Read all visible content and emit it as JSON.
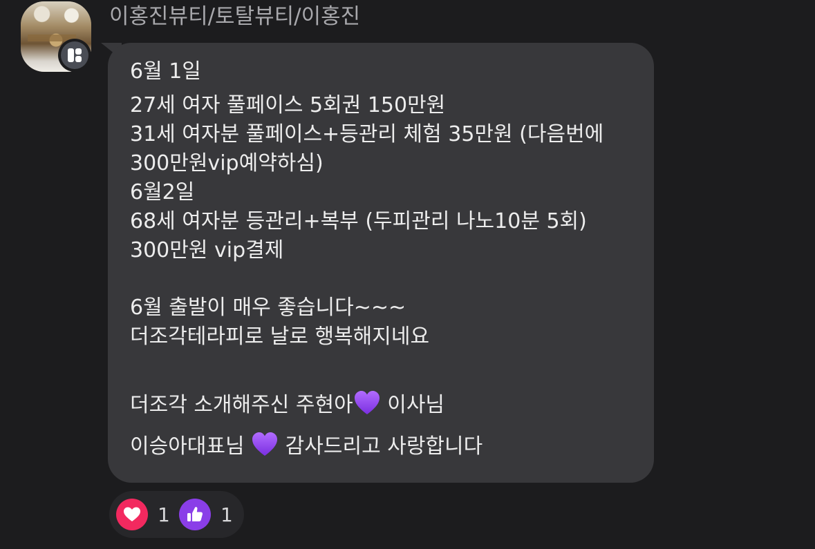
{
  "sender": {
    "name": "이홍진뷰티/토탈뷰티/이홍진"
  },
  "message": {
    "lines": [
      "6월 1일",
      "27세 여자   풀페이스 5회권 150만원",
      "31세 여자분 풀페이스+등관리 체험 35만원 (다음번에",
      "300만원vip예약하심)",
      "6월2일",
      "68세 여자분 등관리+복부 (두피관리 나노10분 5회)",
      "300만원 vip결제",
      "6월 출발이 매우 좋습니다~~~",
      "더조각테라피로 날로 행복해지네요"
    ],
    "thanks_line_1": {
      "before": "더조각 소개해주신 주현아",
      "after": " 이사님"
    },
    "thanks_line_2": {
      "before": "이승아대표님 ",
      "after": " 감사드리고 사랑합니다"
    }
  },
  "reactions": [
    {
      "icon": "heart-icon",
      "count": "1",
      "color": "#f2295f"
    },
    {
      "icon": "thumbs-up-icon",
      "count": "1",
      "color": "#8a3ee8"
    }
  ],
  "colors": {
    "background": "#1c1c1e",
    "bubble": "#38383b",
    "text": "#ededed",
    "sender_name": "#a8a8ac",
    "purple_heart": "#9b4ff0"
  }
}
